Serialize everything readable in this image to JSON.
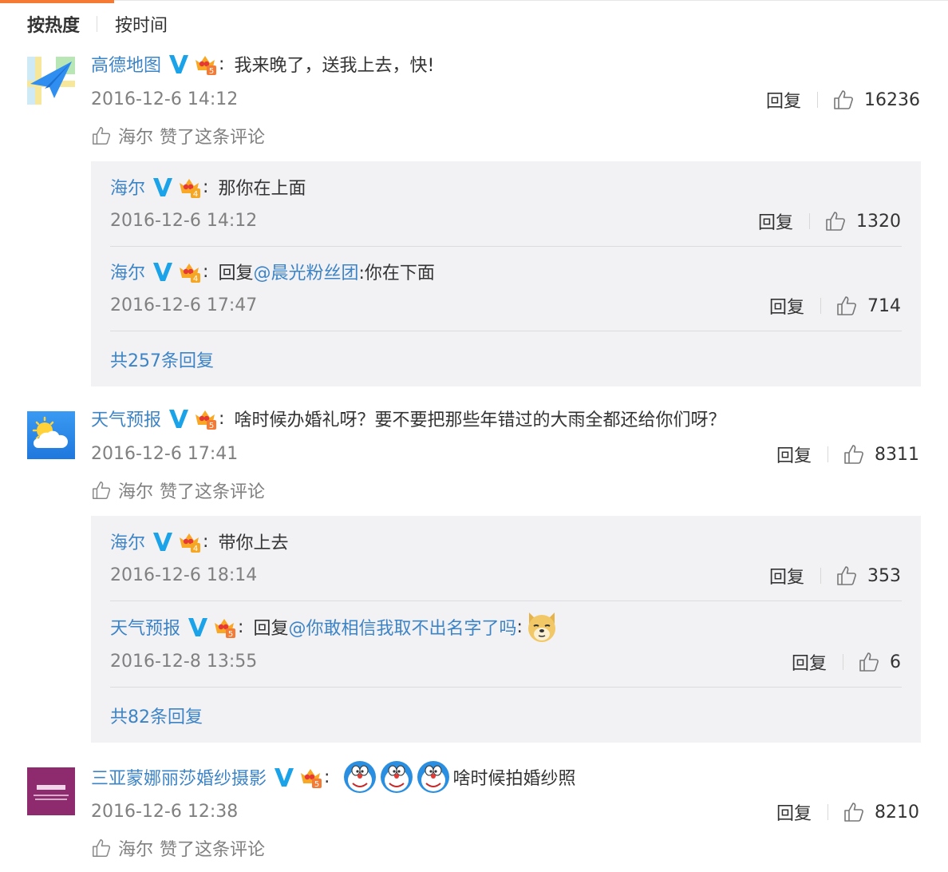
{
  "colors": {
    "accent_orange": "#f57a34",
    "link_blue": "#3d84c6",
    "vip_blue": "#1aa3e8",
    "crown_orange": "#f8a825"
  },
  "sort": {
    "hot": "按热度",
    "time": "按时间"
  },
  "ui": {
    "reply": "回复",
    "liked_suffix": "赞了这条评论"
  },
  "comments": [
    {
      "user": "高德地图",
      "vip_level": "5",
      "text": "我来晚了，送我上去，快!",
      "time": "2016-12-6 14:12",
      "likes": "16236",
      "avatar_icon": "paper-plane-map-icon",
      "liked_by": "海尔",
      "replies": [
        {
          "user": "海尔",
          "vip_level": "4",
          "text": "那你在上面",
          "time": "2016-12-6 14:12",
          "likes": "1320"
        },
        {
          "user": "海尔",
          "vip_level": "4",
          "prefix": "回复",
          "mention": "@晨光粉丝团",
          "text": ":你在下面",
          "time": "2016-12-6 17:47",
          "likes": "714"
        }
      ],
      "more": "共257条回复"
    },
    {
      "user": "天气预报",
      "vip_level": "5",
      "text": "啥时候办婚礼呀？要不要把那些年错过的大雨全都还给你们呀？",
      "time": "2016-12-6 17:41",
      "likes": "8311",
      "avatar_icon": "sun-cloud-icon",
      "liked_by": "海尔",
      "replies": [
        {
          "user": "海尔",
          "vip_level": "4",
          "text": "带你上去",
          "time": "2016-12-6 18:14",
          "likes": "353"
        },
        {
          "user": "天气预报",
          "vip_level": "5",
          "prefix": "回复",
          "mention": "@你敢相信我取不出名字了吗",
          "text": ":",
          "emoji": "doge-emoji",
          "time": "2016-12-8 13:55",
          "likes": "6"
        }
      ],
      "more": "共82条回复"
    },
    {
      "user": "三亚蒙娜丽莎婚纱摄影",
      "vip_level": "5",
      "emojis": [
        "doraemon-emoji",
        "doraemon-emoji",
        "doraemon-emoji"
      ],
      "text": "啥时候拍婚纱照",
      "time": "2016-12-6 12:38",
      "likes": "8210",
      "avatar_icon": "wedding-studio-logo",
      "liked_by": "海尔"
    }
  ]
}
